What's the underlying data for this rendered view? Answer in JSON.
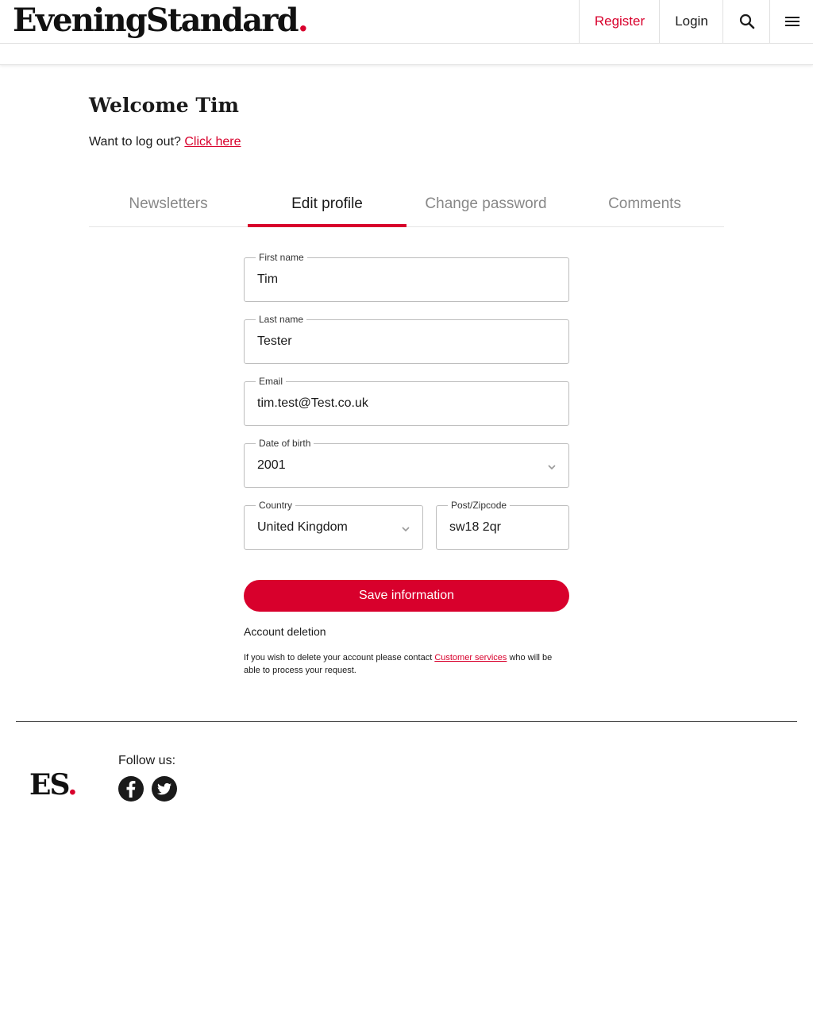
{
  "header": {
    "logo_text": "EveningStandard",
    "logo_dot": ".",
    "register_label": "Register",
    "login_label": "Login",
    "search_icon": "search-icon",
    "menu_icon": "hamburger-menu-icon"
  },
  "main": {
    "welcome": "Welcome Tim",
    "logout_prompt": "Want to log out?",
    "logout_link": "Click here",
    "tabs": [
      {
        "label": "Newsletters",
        "active": false
      },
      {
        "label": "Edit profile",
        "active": true
      },
      {
        "label": "Change password",
        "active": false
      },
      {
        "label": "Comments",
        "active": false
      }
    ]
  },
  "form": {
    "first_name": {
      "label": "First name",
      "value": "Tim"
    },
    "last_name": {
      "label": "Last name",
      "value": "Tester"
    },
    "email": {
      "label": "Email",
      "value": "tim.test@Test.co.uk"
    },
    "dob": {
      "label": "Date of birth",
      "value": "2001"
    },
    "country": {
      "label": "Country",
      "value": "United Kingdom"
    },
    "postcode": {
      "label": "Post/Zipcode",
      "value": "sw18 2qr"
    },
    "save_label": "Save information"
  },
  "account_deletion": {
    "heading": "Account deletion",
    "text_before": "If you wish to delete your account please contact ",
    "link": "Customer services",
    "text_after": " who will be able to process your request."
  },
  "footer": {
    "logo_text": "ES",
    "logo_dot": ".",
    "follow_label": "Follow us:",
    "social": [
      "facebook-icon",
      "twitter-icon"
    ]
  },
  "colors": {
    "accent": "#d8002c",
    "text": "#1a1a1a",
    "muted": "#888888"
  }
}
